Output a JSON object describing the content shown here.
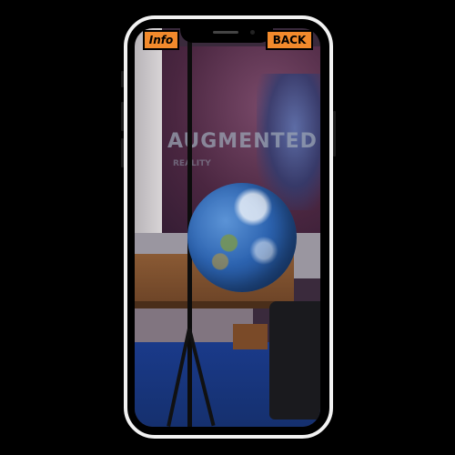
{
  "overlay": {
    "info_label": "Info",
    "back_label": "BACK"
  },
  "scene": {
    "banner_text": "AUGMENTED",
    "banner_sub": "REALITY"
  },
  "colors": {
    "button_bg": "#f28a2c",
    "phone_frame": "#f2f2f2"
  }
}
